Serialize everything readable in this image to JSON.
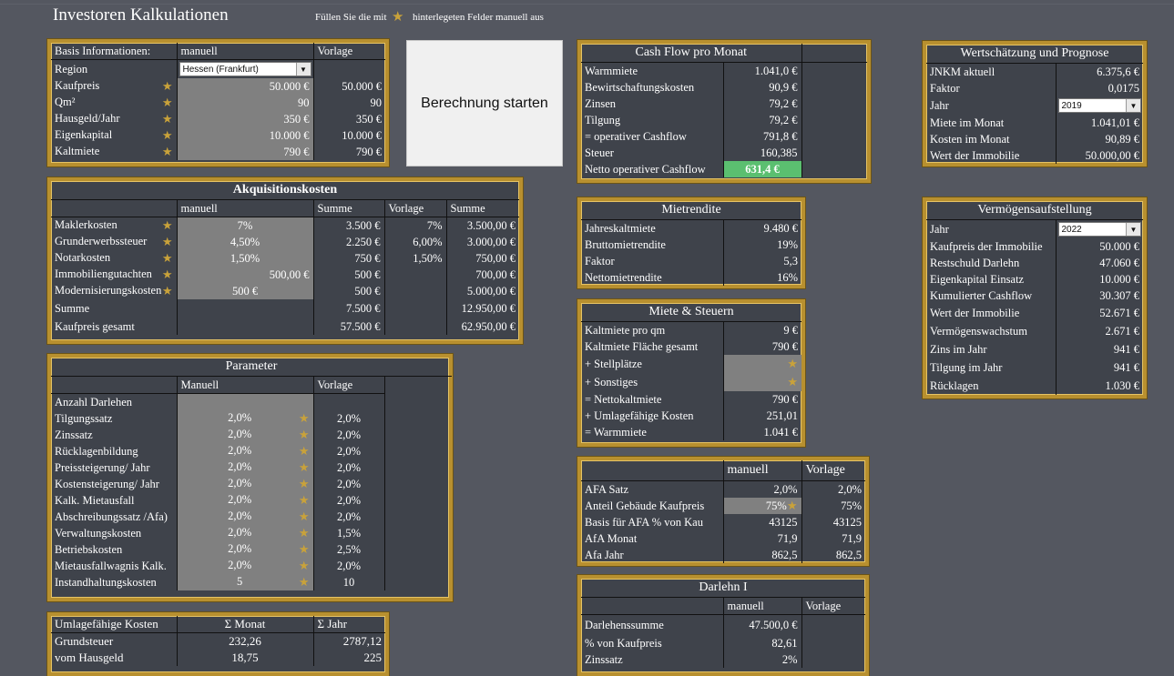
{
  "header": {
    "title": "Investoren Kalkulationen",
    "hint_before": "Füllen Sie die mit",
    "hint_after": "hinterlegeten Felder manuell aus"
  },
  "button": {
    "label": "Berechnung starten"
  },
  "basis": {
    "h1": "Basis Informationen:",
    "h2": "manuell",
    "h3": "Vorlage",
    "region_label": "Region",
    "region_value": "Hessen (Frankfurt)",
    "rows": [
      {
        "label": "Kaufpreis",
        "manuell": "50.000 €",
        "vorlage": "50.000 €"
      },
      {
        "label": "Qm²",
        "manuell": "90",
        "vorlage": "90"
      },
      {
        "label": "Hausgeld/Jahr",
        "manuell": "350 €",
        "vorlage": "350 €"
      },
      {
        "label": "Eigenkapital",
        "manuell": "10.000 €",
        "vorlage": "10.000 €"
      },
      {
        "label": "Kaltmiete",
        "manuell": "790 €",
        "vorlage": "790 €"
      }
    ]
  },
  "akquisition": {
    "title": "Akquisitionskosten",
    "cols": [
      "manuell",
      "Summe",
      "Vorlage",
      "Summe"
    ],
    "rows": [
      {
        "label": "Maklerkosten",
        "manuell": "7%",
        "summe1": "3.500 €",
        "vorlage": "7%",
        "summe2": "3.500,00 €"
      },
      {
        "label": "Grunderwerbssteuer",
        "manuell": "4,50%",
        "summe1": "2.250 €",
        "vorlage": "6,00%",
        "summe2": "3.000,00 €"
      },
      {
        "label": "Notarkosten",
        "manuell": "1,50%",
        "summe1": "750 €",
        "vorlage": "1,50%",
        "summe2": "750,00 €"
      },
      {
        "label": "Immobiliengutachten",
        "manuell": "500,00 €",
        "summe1": "500 €",
        "vorlage": "",
        "summe2": "700,00 €"
      },
      {
        "label": "Modernisierungskosten",
        "manuell": "500 €",
        "summe1": "500 €",
        "vorlage": "",
        "summe2": "5.000,00 €"
      }
    ],
    "summe_label": "Summe",
    "summe1": "7.500 €",
    "summe2": "12.950,00 €",
    "gesamt_label": "Kaufpreis gesamt",
    "gesamt1": "57.500 €",
    "gesamt2": "62.950,00 €"
  },
  "parameter": {
    "title": "Parameter",
    "col1": "Manuell",
    "col2": "Vorlage",
    "rows": [
      {
        "label": "Anzahl Darlehen",
        "manuell": "",
        "vorlage": ""
      },
      {
        "label": "Tilgungssatz",
        "manuell": "2,0%",
        "vorlage": "2,0%"
      },
      {
        "label": "Zinssatz",
        "manuell": "2,0%",
        "vorlage": "2,0%"
      },
      {
        "label": "Rücklagenbildung",
        "manuell": "2,0%",
        "vorlage": "2,0%"
      },
      {
        "label": "Preissteigerung/ Jahr",
        "manuell": "2,0%",
        "vorlage": "2,0%"
      },
      {
        "label": "Kostensteigerung/ Jahr",
        "manuell": "2,0%",
        "vorlage": "2,0%"
      },
      {
        "label": "Kalk. Mietausfall",
        "manuell": "2,0%",
        "vorlage": "2,0%"
      },
      {
        "label": "Abschreibungssatz /Afa)",
        "manuell": "2,0%",
        "vorlage": "2,0%"
      },
      {
        "label": "Verwaltungskosten",
        "manuell": "2,0%",
        "vorlage": "1,5%"
      },
      {
        "label": "Betriebskosten",
        "manuell": "2,0%",
        "vorlage": "2,5%"
      },
      {
        "label": "Mietausfallwagnis Kalk.",
        "manuell": "2,0%",
        "vorlage": "2,0%"
      },
      {
        "label": "Instandhaltungskosten",
        "manuell": "5",
        "vorlage": "10"
      }
    ]
  },
  "umlage": {
    "c1": "Umlagefähige Kosten",
    "c2": "Σ Monat",
    "c3": "Σ Jahr",
    "rows": [
      {
        "label": "Grundsteuer",
        "monat": "232,26",
        "jahr": "2787,12"
      },
      {
        "label": "vom Hausgeld",
        "monat": "18,75",
        "jahr": "225"
      }
    ]
  },
  "cashflow": {
    "title": "Cash Flow pro Monat",
    "rows": [
      {
        "label": "Warmmiete",
        "value": "1.041,0 €"
      },
      {
        "label": "Bewirtschaftungskosten",
        "value": "90,9 €"
      },
      {
        "label": "Zinsen",
        "value": "79,2 €"
      },
      {
        "label": "Tilgung",
        "value": "79,2 €"
      },
      {
        "label": " = operativer Cashflow",
        "value": "791,8 €"
      },
      {
        "label": "Steuer",
        "value": "160,385"
      }
    ],
    "netto_label": "Netto operativer Cashflow",
    "netto_value": "631,4 €"
  },
  "mietrendite": {
    "title": "Mietrendite",
    "rows": [
      {
        "label": "Jahreskaltmiete",
        "value": "9.480 €"
      },
      {
        "label": "Bruttomietrendite",
        "value": "19%"
      },
      {
        "label": "Faktor",
        "value": "5,3"
      },
      {
        "label": "Nettomietrendite",
        "value": "16%"
      }
    ]
  },
  "miete": {
    "title": "Miete & Steuern",
    "rows": [
      {
        "label": "Kaltmiete pro qm",
        "value": "9 €"
      },
      {
        "label": "Kaltmiete Fläche gesamt",
        "value": "790 €"
      },
      {
        "label": " + Stellplätze",
        "value": ""
      },
      {
        "label": " + Sonstiges",
        "value": ""
      },
      {
        "label": " = Nettokaltmiete",
        "value": "790 €"
      },
      {
        "label": " + Umlagefähige Kosten",
        "value": "251,01"
      },
      {
        "label": " = Warmmiete",
        "value": "1.041 €"
      }
    ]
  },
  "afa": {
    "col1": "manuell",
    "col2": "Vorlage",
    "rows": [
      {
        "label": "AFA Satz",
        "manuell": "2,0%",
        "vorlage": "2,0%"
      },
      {
        "label": "Anteil Gebäude Kaufpreis",
        "manuell": "75%",
        "vorlage": "75%"
      },
      {
        "label": "Basis für  AFA % von Kau",
        "manuell": "43125",
        "vorlage": "43125"
      },
      {
        "label": "AfA Monat",
        "manuell": "71,9",
        "vorlage": "71,9"
      },
      {
        "label": "Afa Jahr",
        "manuell": "862,5",
        "vorlage": "862,5"
      }
    ]
  },
  "darlehn": {
    "title": "Darlehn I",
    "col1": "manuell",
    "col2": "Vorlage",
    "rows": [
      {
        "label": "Darlehenssumme",
        "manuell": "47.500,0 €",
        "vorlage": ""
      },
      {
        "label": "% von Kaufpreis",
        "manuell": "82,61",
        "vorlage": ""
      },
      {
        "label": "Zinssatz",
        "manuell": "2%",
        "vorlage": ""
      }
    ]
  },
  "wert": {
    "title": "Wertschätzung  und Prognose",
    "rows": [
      {
        "label": "JNKM aktuell",
        "value": "6.375,6 €"
      },
      {
        "label": "Faktor",
        "value": "0,0175"
      },
      {
        "label": "Jahr",
        "value": "2019"
      },
      {
        "label": "Miete im Monat",
        "value": "1.041,01 €"
      },
      {
        "label": "Kosten im Monat",
        "value": "90,89 €"
      },
      {
        "label": "Wert der Immobilie",
        "value": "50.000,00 €"
      }
    ]
  },
  "vermoegen": {
    "title": "Vermögensaufstellung",
    "rows": [
      {
        "label": "Jahr",
        "value": "2022"
      },
      {
        "label": "Kaufpreis der Immobilie",
        "value": "50.000 €"
      },
      {
        "label": "Restschuld Darlehn",
        "value": "47.060 €"
      },
      {
        "label": "Eigenkapital Einsatz",
        "value": "10.000 €"
      },
      {
        "label": "Kumulierter Cashflow",
        "value": "30.307 €"
      },
      {
        "label": "Wert der Immobilie",
        "value": "52.671 €"
      },
      {
        "label": "Vermögenswachstum",
        "value": "2.671 €"
      },
      {
        "label": "Zins im Jahr",
        "value": "941 €"
      },
      {
        "label": "Tilgung im Jahr",
        "value": "941 €"
      },
      {
        "label": "Rücklagen",
        "value": "1.030 €"
      }
    ]
  }
}
